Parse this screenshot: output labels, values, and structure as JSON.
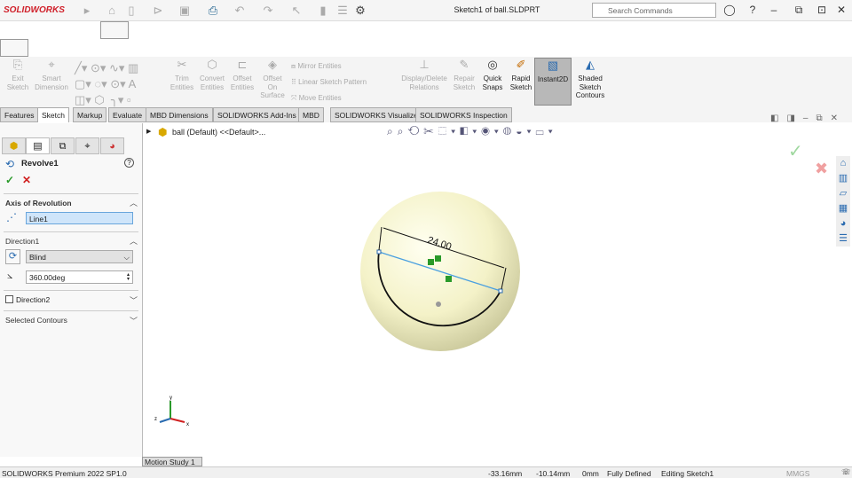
{
  "app": {
    "brand": "SOLIDWORKS",
    "title": "Sketch1 of ball.SLDPRT",
    "search_placeholder": "Search Commands"
  },
  "ribbon": {
    "items": [
      {
        "label": "Exit\nSketch"
      },
      {
        "label": "Smart\nDimension"
      },
      {
        "label": "Trim\nEntities"
      },
      {
        "label": "Convert\nEntities"
      },
      {
        "label": "Offset\nEntities"
      },
      {
        "label": "Offset\nOn\nSurface"
      },
      {
        "label": "Mirror Entities"
      },
      {
        "label": "Linear Sketch Pattern"
      },
      {
        "label": "Move Entities"
      },
      {
        "label": "Display/Delete\nRelations"
      },
      {
        "label": "Repair\nSketch"
      },
      {
        "label": "Quick\nSnaps"
      },
      {
        "label": "Rapid\nSketch"
      },
      {
        "label": "Instant2D"
      },
      {
        "label": "Shaded\nSketch\nContours"
      }
    ]
  },
  "tabs": [
    "Features",
    "Sketch",
    "Markup",
    "Evaluate",
    "MBD Dimensions",
    "SOLIDWORKS Add-Ins",
    "MBD",
    "SOLIDWORKS Visualize",
    "SOLIDWORKS Inspection"
  ],
  "panel": {
    "feature": "Revolve1",
    "axis_title": "Axis of Revolution",
    "axis_value": "Line1",
    "dir1_title": "Direction1",
    "dir1_type": "Blind",
    "angle": "360.00deg",
    "dir2_title": "Direction2",
    "contours_title": "Selected Contours"
  },
  "tree": {
    "root": "ball (Default) <<Default>..."
  },
  "sketch": {
    "dimension": "24.00"
  },
  "motion_tab": "Motion Study 1",
  "status": {
    "product": "SOLIDWORKS Premium 2022 SP1.0",
    "x": "-33.16mm",
    "y": "-10.14mm",
    "z": "0mm",
    "state": "Fully Defined",
    "mode": "Editing Sketch1",
    "units": "MMGS"
  }
}
